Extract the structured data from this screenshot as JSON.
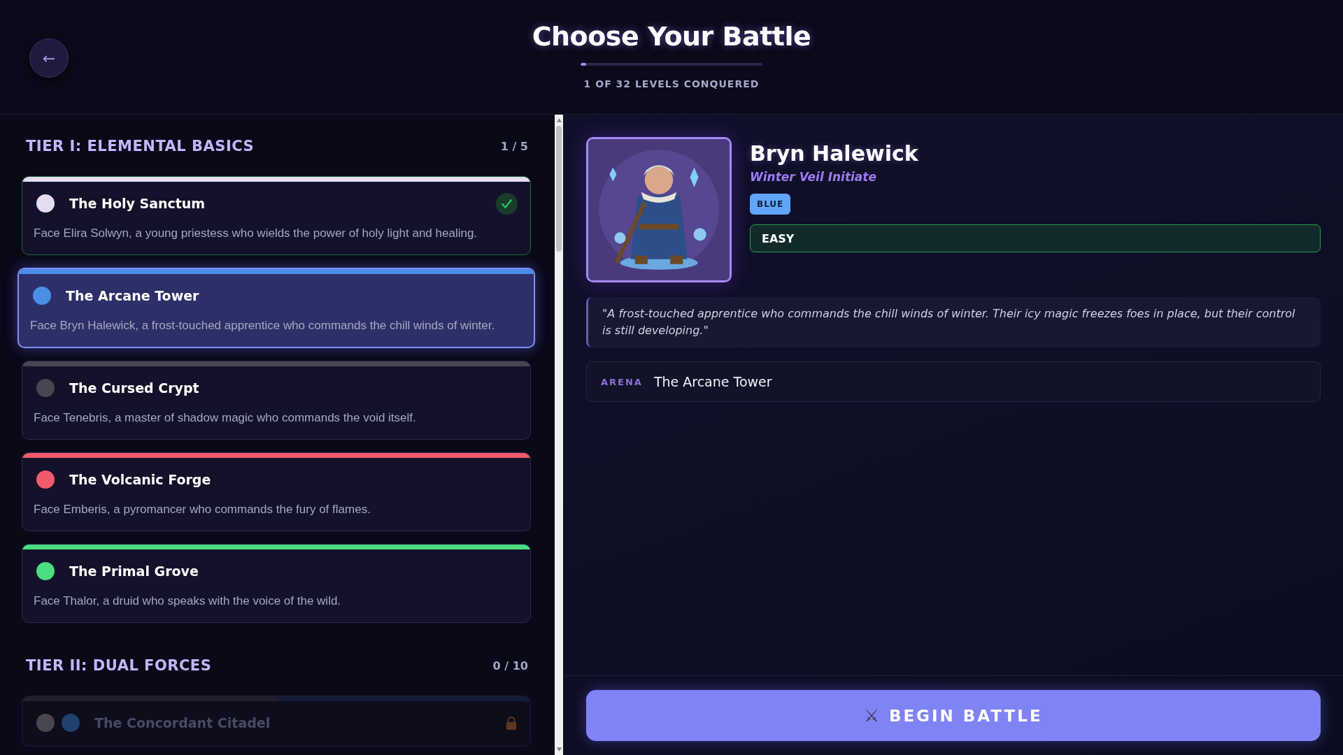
{
  "header": {
    "back_button": "←",
    "title": "Choose Your Battle",
    "progress": {
      "level": 0.03
    },
    "progress_label": "1 OF 32 LEVELS CONQUERED"
  },
  "tiers": [
    {
      "title": "TIER I: ELEMENTAL BASICS",
      "count": "1 / 5",
      "levels": [
        {
          "name": "The Holy Sanctum",
          "description": "Face Elira Solwyn, a young priestess who wields the power of holy light and healing.",
          "orbs": [
            {
              "color": "#e6dcf0"
            }
          ],
          "completed": true,
          "selected": false,
          "locked": false
        },
        {
          "name": "The Arcane Tower",
          "description": "Face Bryn Halewick, a frost-touched apprentice who commands the chill winds of winter.",
          "orbs": [
            {
              "color": "#4a8ee8"
            }
          ],
          "completed": false,
          "selected": true,
          "locked": false
        },
        {
          "name": "The Cursed Crypt",
          "description": "Face Tenebris, a master of shadow magic who commands the void itself.",
          "orbs": [
            {
              "color": "#4a4552"
            }
          ],
          "completed": false,
          "selected": false,
          "locked": false
        },
        {
          "name": "The Volcanic Forge",
          "description": "Face Emberis, a pyromancer who commands the fury of flames.",
          "orbs": [
            {
              "color": "#f05a6a"
            }
          ],
          "completed": false,
          "selected": false,
          "locked": false
        },
        {
          "name": "The Primal Grove",
          "description": "Face Thalor, a druid who speaks with the voice of the wild.",
          "orbs": [
            {
              "color": "#4ade80"
            }
          ],
          "completed": false,
          "selected": false,
          "locked": false
        }
      ]
    },
    {
      "title": "TIER II: DUAL FORCES",
      "count": "0 / 10",
      "levels": [
        {
          "name": "The Concordant Citadel",
          "orbs": [
            {
              "color": "#4a4650"
            },
            {
              "color": "#22406e"
            }
          ],
          "completed": false,
          "selected": false,
          "locked": true
        }
      ]
    }
  ],
  "detail": {
    "name": "Bryn Halewick",
    "subtitle": "Winter Veil Initiate",
    "element": {
      "label": "BLUE",
      "color": "#60a5fa"
    },
    "difficulty": {
      "label": "EASY",
      "kind": "easy"
    },
    "quote": "\"A frost-touched apprentice who commands the chill winds of winter. Their icy magic freezes foes in place, but their control is still developing.\"",
    "arena_label": "ARENA",
    "arena": "The Arcane Tower"
  },
  "begin_button": {
    "icon": "⚔",
    "label": "BEGIN BATTLE"
  }
}
